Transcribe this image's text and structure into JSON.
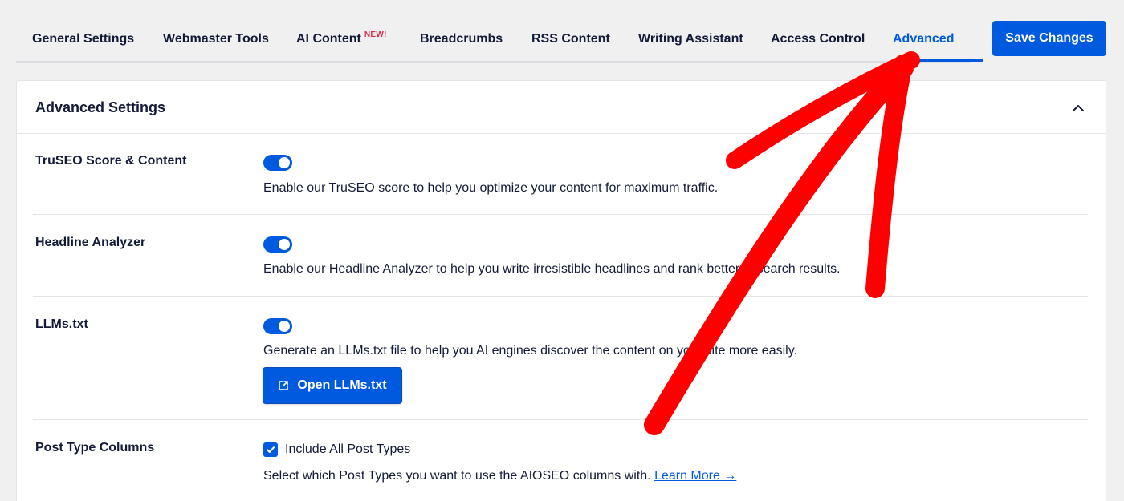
{
  "tabs": [
    {
      "label": "General Settings"
    },
    {
      "label": "Webmaster Tools"
    },
    {
      "label": "AI Content",
      "badge": "NEW!"
    },
    {
      "label": "Breadcrumbs"
    },
    {
      "label": "RSS Content"
    },
    {
      "label": "Writing Assistant"
    },
    {
      "label": "Access Control"
    },
    {
      "label": "Advanced",
      "active": true
    }
  ],
  "header": {
    "save_label": "Save Changes"
  },
  "card": {
    "title": "Advanced Settings",
    "collapse_icon": "chevron-up-icon",
    "rows": [
      {
        "label": "TruSEO Score & Content",
        "enabled": true,
        "description": "Enable our TruSEO score to help you optimize your content for maximum traffic."
      },
      {
        "label": "Headline Analyzer",
        "enabled": true,
        "description": "Enable our Headline Analyzer to help you write irresistible headlines and rank better in search results."
      },
      {
        "label": "LLMs.txt",
        "enabled": true,
        "description": "Generate an LLMs.txt file to help you AI engines discover the content on your site more easily.",
        "button_label": "Open LLMs.txt",
        "button_icon": "external-link-icon"
      },
      {
        "label": "Post Type Columns",
        "checkbox_label": "Include All Post Types",
        "checkbox_checked": true,
        "description": "Select which Post Types you want to use the AIOSEO columns with.",
        "link_label": "Learn More →"
      }
    ]
  },
  "colors": {
    "accent": "#005ae0",
    "badge": "#df2a4a",
    "annotation_arrow": "#ff0000"
  }
}
